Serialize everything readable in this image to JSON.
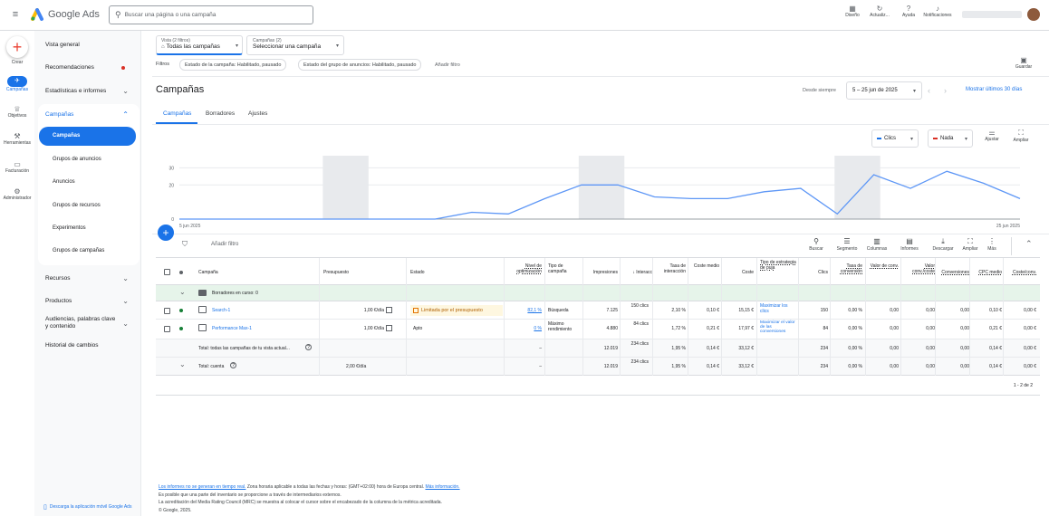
{
  "app": {
    "name": "Google Ads",
    "search_placeholder": "Buscar una página o una campaña"
  },
  "header_actions": [
    {
      "icon": "palette-icon",
      "label": "Diseño"
    },
    {
      "icon": "refresh-icon",
      "label": "Actualiz..."
    },
    {
      "icon": "help-icon",
      "label": "Ayuda"
    },
    {
      "icon": "bell-icon",
      "label": "Notificaciones"
    }
  ],
  "rail": {
    "create": "Crear",
    "items": [
      {
        "icon": "campaigns-icon",
        "label": "Campañas"
      },
      {
        "icon": "trophy-icon",
        "label": "Objetivos"
      },
      {
        "icon": "tools-icon",
        "label": "Herramientas"
      },
      {
        "icon": "card-icon",
        "label": "Facturación"
      },
      {
        "icon": "gear-icon",
        "label": "Administrador"
      }
    ]
  },
  "nav": {
    "items": [
      "Vista general",
      "Recomendaciones",
      "Estadísticas e informes"
    ],
    "campaigns": "Campañas",
    "sub": [
      "Campañas",
      "Grupos de anuncios",
      "Anuncios",
      "Grupos de recursos",
      "Experimentos",
      "Grupos de campañas"
    ],
    "after": [
      "Recursos",
      "Productos",
      "Audiencias, palabras clave y contenido",
      "Historial de cambios"
    ],
    "app_download": "Descarga la aplicación móvil Google Ads"
  },
  "filters": {
    "view_label": "Vista (2 filtros)",
    "view_value": "Todas las campañas",
    "campaigns_label": "Campañas (2)",
    "campaigns_value": "Seleccionar una campaña",
    "filtros": "Filtros",
    "chip1": "Estado de la campaña: Habilitado, pausado",
    "chip2": "Estado del grupo de anuncios: Habilitado, pausado",
    "add": "Añadir filtro",
    "save": "Guardar"
  },
  "page": {
    "title": "Campañas",
    "since": "Desde siempre",
    "date_range": "5 – 25 jun de 2025",
    "show_last": "Mostrar últimos 30 días",
    "tabs": [
      "Campañas",
      "Borradores",
      "Ajustes"
    ]
  },
  "chart_controls": {
    "metric1": "Clics",
    "metric2": "Nada",
    "adjust": "Ajustar",
    "expand": "Ampliar"
  },
  "chart_data": {
    "type": "line",
    "series": [
      {
        "values": [
          0,
          0,
          0,
          0,
          0,
          0,
          0,
          0,
          4,
          3,
          12,
          20,
          20,
          13,
          12,
          12,
          16,
          18,
          3,
          26,
          18,
          28,
          21,
          12
        ]
      }
    ],
    "xlabel_start": "5 jun 2025",
    "xlabel_end": "25 jun 2025",
    "yticks": [
      "0",
      "20",
      "30"
    ],
    "ylim": [
      0,
      35
    ]
  },
  "table_tools": {
    "add_filter": "Añadir filtro",
    "tools": [
      {
        "icon": "search-icon",
        "label": "Buscar"
      },
      {
        "icon": "segment-icon",
        "label": "Segmento"
      },
      {
        "icon": "columns-icon",
        "label": "Columnas"
      },
      {
        "icon": "reports-icon",
        "label": "Informes"
      },
      {
        "icon": "download-icon",
        "label": "Descargar"
      },
      {
        "icon": "expand-icon",
        "label": "Ampliar"
      },
      {
        "icon": "more-icon",
        "label": "Más"
      }
    ]
  },
  "table": {
    "headers": [
      "Campaña",
      "Presupuesto",
      "Estado",
      "Nivel de optimización",
      "Tipo de campaña",
      "Impresiones",
      "↓ Interacc",
      "Tasa de interacción",
      "Coste medio",
      "Coste",
      "Tipo de estrategia de puja",
      "Clics",
      "Tasa de conversión",
      "Valor de conv.",
      "Valor conv./coste",
      "Conversiones",
      "CPC medio",
      "Coste/conv."
    ],
    "drafts": "Borradores en curso: 0",
    "rows": [
      {
        "name": "Search-1",
        "budget": "1,00 €/día",
        "status": "Limitada por el presupuesto",
        "opt": "82,1 %",
        "type": "Búsqueda",
        "impr": "7.125",
        "inter": "150 clics",
        "rate": "2,10 %",
        "avg": "0,10 €",
        "cost": "15,15 €",
        "strategy": "Maximizar los clics",
        "clicks": "150",
        "convr": "0,00 %",
        "convv": "0,00",
        "vpc": "0,00",
        "conv": "0,00",
        "cpc": "0,10 €",
        "cpa": "0,00 €"
      },
      {
        "name": "Performance Max-1",
        "budget": "1,00 €/día",
        "status": "Apto",
        "opt": "0 %",
        "type": "Máximo rendimiento",
        "impr": "4.880",
        "inter": "84 clics",
        "rate": "1,72 %",
        "avg": "0,21 €",
        "cost": "17,97 €",
        "strategy": "Maximizar el valor de las conversiones",
        "clicks": "84",
        "convr": "0,00 %",
        "convv": "0,00",
        "vpc": "0,00",
        "conv": "0,00",
        "cpc": "0,21 €",
        "cpa": "0,00 €"
      }
    ],
    "total1": {
      "label": "Total: todas las campañas de tu vista actual...",
      "opt": "–",
      "impr": "12.019",
      "inter": "234 clics",
      "rate": "1,95 %",
      "avg": "0,14 €",
      "cost": "33,12 €",
      "clicks": "234",
      "convr": "0,00 %",
      "convv": "0,00",
      "vpc": "0,00",
      "conv": "0,00",
      "cpc": "0,14 €",
      "cpa": "0,00 €"
    },
    "total2": {
      "label": "Total: cuenta",
      "budget": "2,00 €/día",
      "opt": "–",
      "impr": "12.019",
      "inter": "234 clics",
      "rate": "1,95 %",
      "avg": "0,14 €",
      "cost": "33,12 €",
      "clicks": "234",
      "convr": "0,00 %",
      "convv": "0,00",
      "vpc": "0,00",
      "conv": "0,00",
      "cpc": "0,14 €",
      "cpa": "0,00 €"
    },
    "pagination": "1 - 2 de 2"
  },
  "footer": {
    "line1_link": "Los informes no se generan en tiempo real.",
    "line1": " Zona horaria aplicable a todas las fechas y horas: (GMT+02:00) hora de Europa central.",
    "line1_more": "Más información.",
    "line2": "Es posible que una parte del inventario se proporcione a través de intermediarios externos.",
    "line3": "La acreditación del Media Rating Council (MRC) se muestra al colocar el cursor sobre el encabezado de la columna de la métrica acreditada.",
    "line4": "© Google, 2025."
  },
  "colors": {
    "blue": "#1a73e8",
    "yellow": "#fbbc04",
    "green": "#188038",
    "red": "#d93025"
  }
}
